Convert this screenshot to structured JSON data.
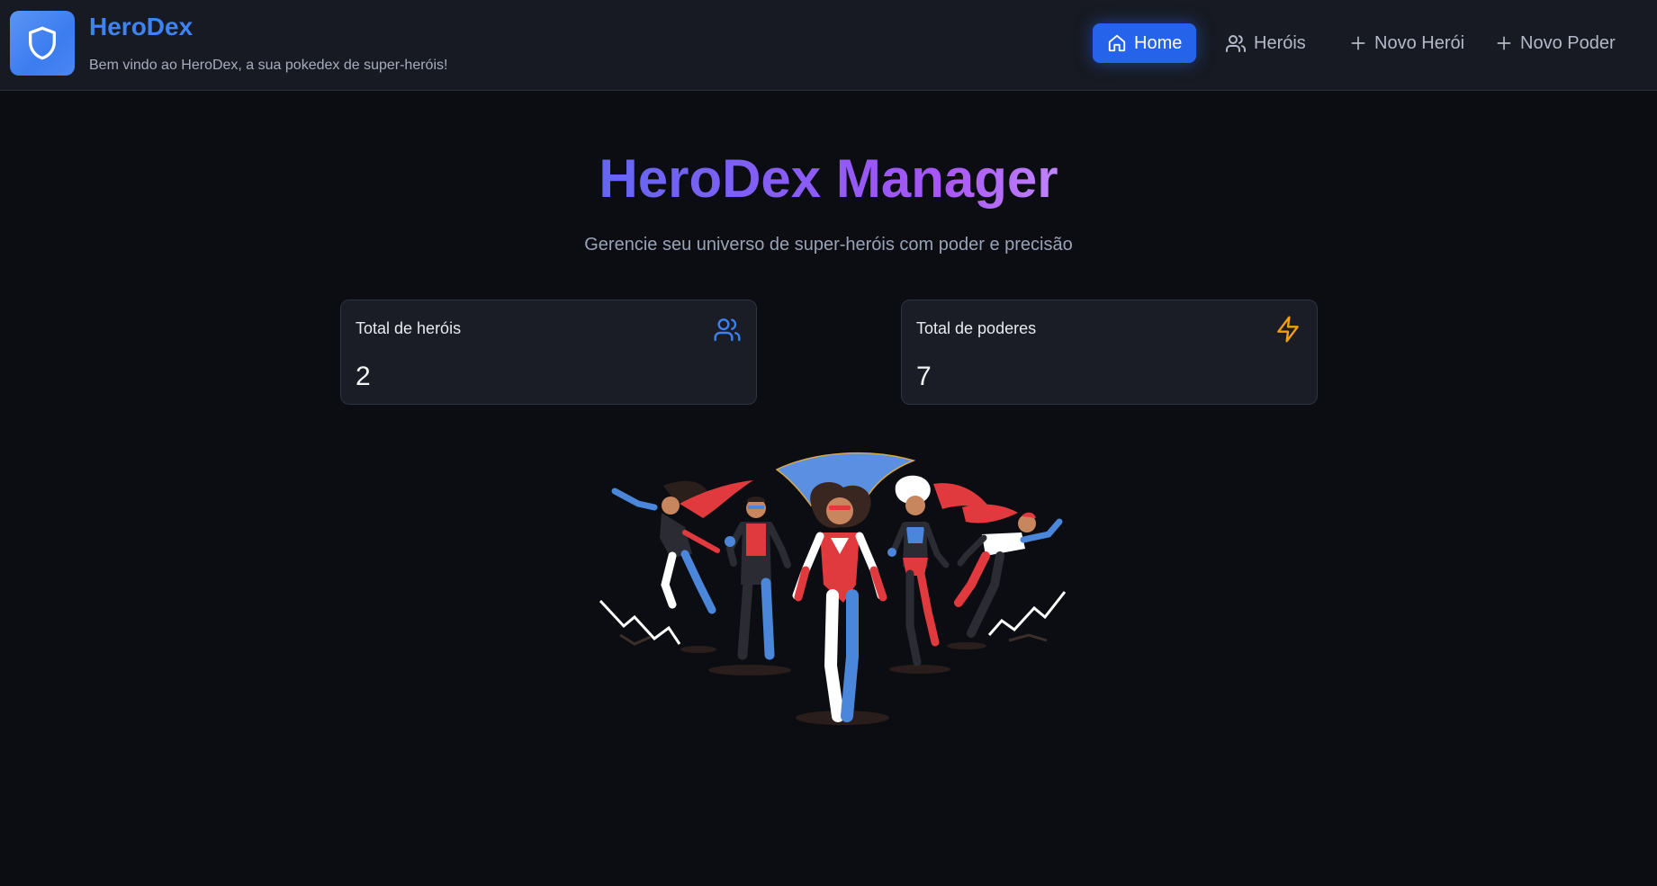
{
  "app": {
    "name": "HeroDex",
    "tagline": "Bem vindo ao HeroDex, a sua pokedex de super-heróis!",
    "logo_icon": "shield-icon"
  },
  "nav": {
    "items": [
      {
        "label": "Home",
        "icon": "home-icon",
        "active": true
      },
      {
        "label": "Heróis",
        "icon": "users-icon",
        "active": false
      },
      {
        "label": "Novo Herói",
        "icon": "plus-icon",
        "active": false
      },
      {
        "label": "Novo Poder",
        "icon": "plus-icon",
        "active": false
      }
    ]
  },
  "main": {
    "title": "HeroDex Manager",
    "subtitle": "Gerencie seu universo de super-heróis com poder e precisão"
  },
  "stats": [
    {
      "label": "Total de heróis",
      "value": "2",
      "icon": "users-icon",
      "color": "#3b82f6"
    },
    {
      "label": "Total de poderes",
      "value": "7",
      "icon": "lightning-icon",
      "color": "#f59e0b"
    }
  ],
  "colors": {
    "accent": "#2563eb",
    "brand": "#3f83f3",
    "background": "#0b0d12",
    "header": "#171a22"
  }
}
